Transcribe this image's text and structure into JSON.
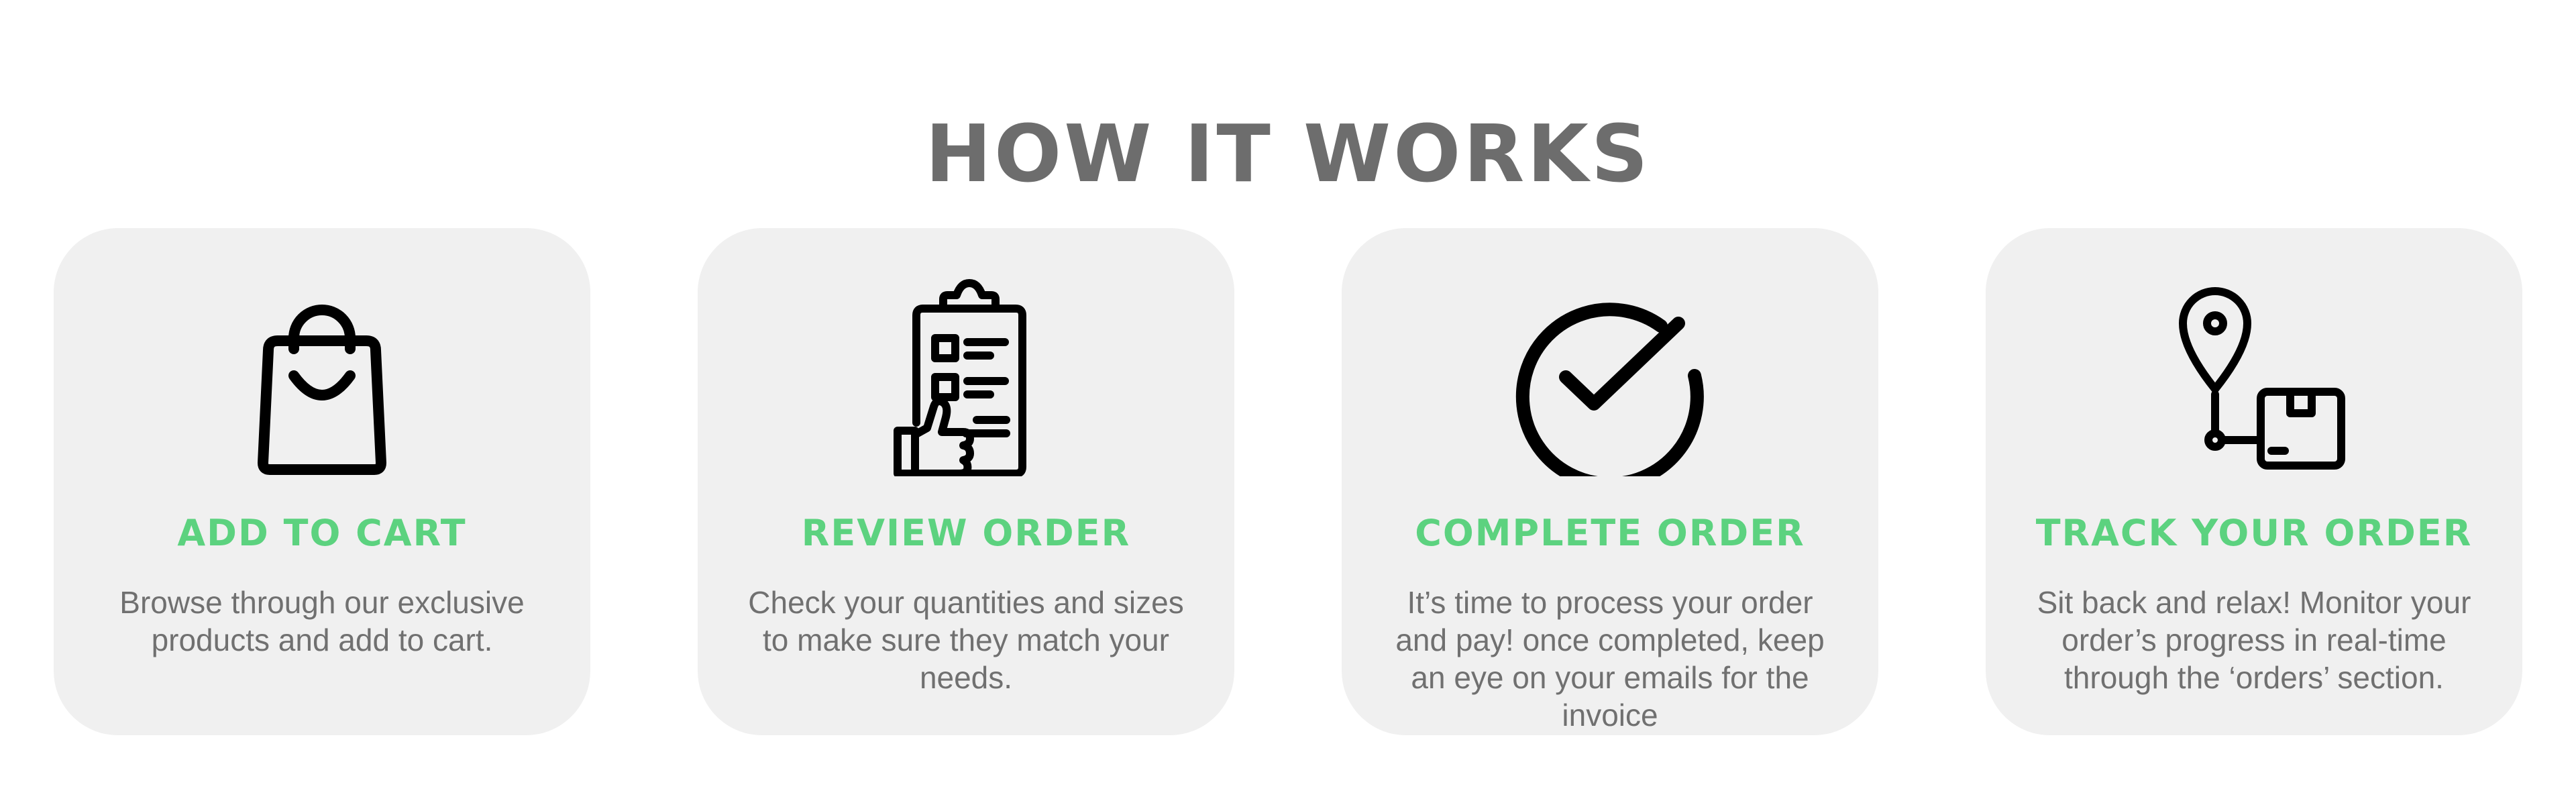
{
  "page": {
    "title": "HOW IT WORKS"
  },
  "colors": {
    "title": "#6d6d6d",
    "card_background": "#f0f0f0",
    "step_title": "#5cd27f",
    "description": "#707070",
    "icon": "#000000"
  },
  "steps": [
    {
      "icon": "shopping-bag-icon",
      "title": "ADD TO CART",
      "description": "Browse through our exclusive products and add to cart."
    },
    {
      "icon": "clipboard-thumbs-up-icon",
      "title": "REVIEW ORDER",
      "description": "Check your quantities and sizes to make sure they match your needs."
    },
    {
      "icon": "checkmark-circle-icon",
      "title": "COMPLETE ORDER",
      "description": "It’s time to process your order and pay! once completed, keep an eye on your emails for the invoice"
    },
    {
      "icon": "location-package-icon",
      "title": "TRACK YOUR ORDER",
      "description": "Sit back and relax! Monitor your order’s progress in real-time through the ‘orders’ section."
    }
  ]
}
